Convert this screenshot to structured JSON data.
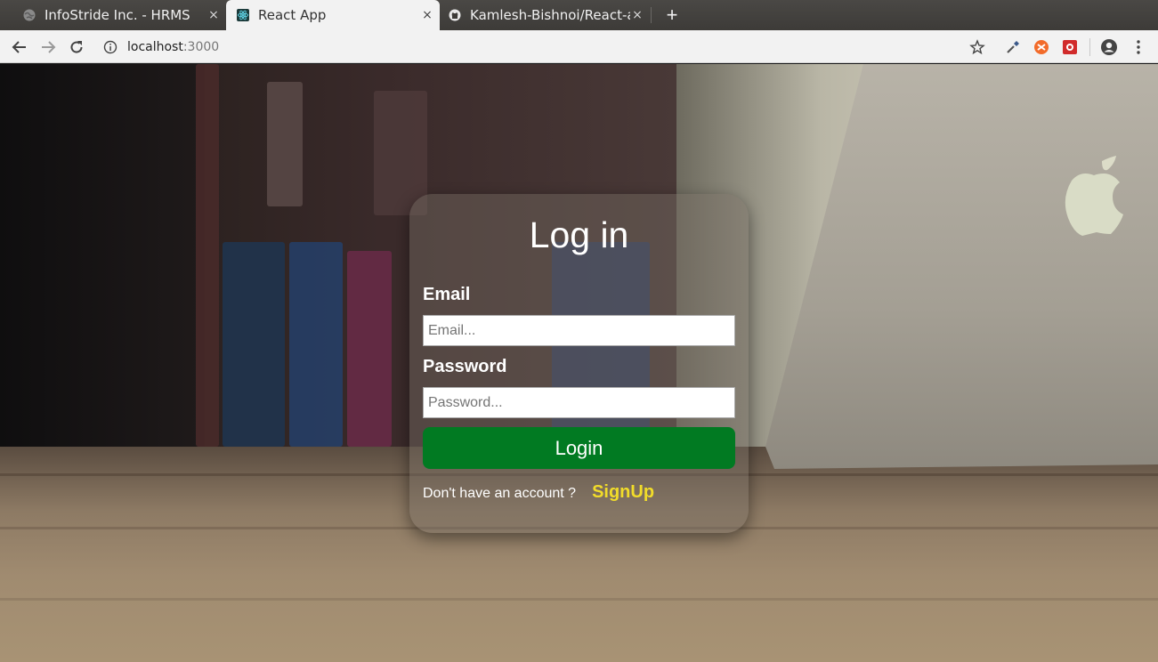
{
  "browser": {
    "tabs": [
      {
        "title": "InfoStride Inc. - HRMS",
        "icon": "globe-icon",
        "active": false
      },
      {
        "title": "React App",
        "icon": "react-icon",
        "active": true
      },
      {
        "title": "Kamlesh-Bishnoi/React-ap",
        "icon": "github-icon",
        "active": false
      }
    ],
    "new_tab": "+",
    "close_glyph": "×",
    "address": {
      "host": "localhost",
      "port": ":3000"
    }
  },
  "login": {
    "title": "Log in",
    "email_label": "Email",
    "email_placeholder": "Email...",
    "email_value": "",
    "password_label": "Password",
    "password_placeholder": "Password...",
    "password_value": "",
    "login_button": "Login",
    "no_account_text": "Don't have an account ?",
    "signup_link": "SignUp"
  },
  "colors": {
    "login_button": "#017a22",
    "signup_link": "#f1dc2a",
    "card_background": "rgba(120,110,100,0.42)"
  }
}
